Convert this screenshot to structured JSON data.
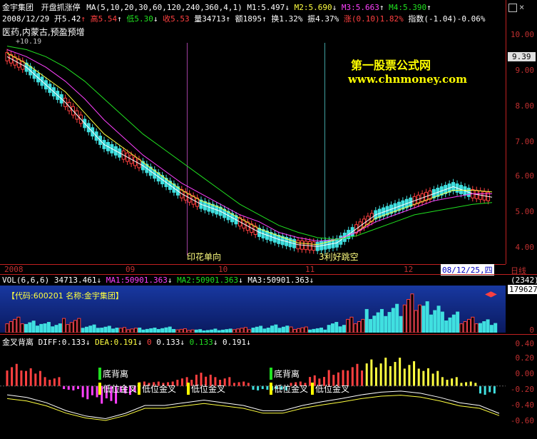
{
  "header": {
    "stock_name": "金宇集团",
    "indicator_name": "开盘抓涨停",
    "ma_params": "MA(5,10,20,30,60,120,240,360,4,1)",
    "m1": "M1:5.497",
    "m2": "M2:5.690",
    "m3": "M3:5.663",
    "m4": "M4:5.390",
    "date": "2008/12/29",
    "open": "开5.42",
    "high": "高5.54",
    "low": "低5.30",
    "close": "收5.53",
    "volume": "量34713",
    "amount": "额1895",
    "turnover": "换1.32%",
    "amplitude": "振4.37%",
    "change": "涨(0.10)1.82%",
    "index": "指数(-1.04)-0.06%",
    "concepts": "医药,内蒙古,预盈预增",
    "extra": "+10.19",
    "arrow_up": "↑",
    "arrow_down": "↓"
  },
  "watermark": {
    "line1": "第一股票公式网",
    "line2": "www.chnmoney.com"
  },
  "price_axis": {
    "labels": [
      "10.00",
      "9.39",
      "9.00",
      "8.00",
      "7.00",
      "6.00",
      "5.00",
      "4.00"
    ],
    "current": "9.39"
  },
  "annotations": {
    "stamp_duty": "印花单向",
    "good_news": "3利好跳空"
  },
  "time_axis": {
    "labels": [
      "2008",
      "09",
      "10",
      "11",
      "12"
    ],
    "cursor_date": "08/12/25,四",
    "period": "日线"
  },
  "vol_panel": {
    "title": "VOL(6,6,6)",
    "value": "34713.461",
    "ma1": "MA1:50901.363",
    "ma2": "MA2:50901.363",
    "ma3": "MA3:50901.363",
    "code_text": "【代码:600201 名称:金宇集团】",
    "axis_top": "(2342)",
    "axis_current": "179627",
    "axis_zero": "0"
  },
  "macd_panel": {
    "title": "金叉背离",
    "diff": "DIFF:0.133",
    "dea": "DEA:0.191",
    "v0": "0",
    "v1": "0.133",
    "v2": "0.133",
    "v3": "0.191",
    "labels_bottom_divergence": [
      "底背离",
      "底背离"
    ],
    "labels_golden_cross": [
      "低位金叉",
      "低位金叉",
      "低位金叉",
      "低位金叉",
      "低位金叉"
    ],
    "axis": [
      "0.40",
      "0.20",
      "0.00",
      "-0.20",
      "-0.40",
      "-0.60"
    ]
  },
  "chart_data": [
    {
      "type": "line",
      "title": "",
      "ylim": [
        3.8,
        10.3
      ],
      "series": [
        {
          "name": "M1",
          "values": [
            9.5,
            9.2,
            8.7,
            8.2,
            7.6,
            7.0,
            6.7,
            6.4,
            6.0,
            5.6,
            5.3,
            5.1,
            4.8,
            4.5,
            4.3,
            4.15,
            4.1,
            4.2,
            4.6,
            5.0,
            5.2,
            5.4,
            5.6,
            5.8,
            5.6,
            5.5
          ]
        },
        {
          "name": "M2",
          "values": [
            9.6,
            9.3,
            8.9,
            8.5,
            7.9,
            7.3,
            6.9,
            6.5,
            6.1,
            5.7,
            5.4,
            5.2,
            4.9,
            4.6,
            4.4,
            4.2,
            4.15,
            4.3,
            4.5,
            4.9,
            5.1,
            5.3,
            5.5,
            5.7,
            5.7,
            5.65
          ]
        },
        {
          "name": "M3",
          "values": [
            9.7,
            9.5,
            9.2,
            8.8,
            8.3,
            7.7,
            7.2,
            6.7,
            6.3,
            5.9,
            5.6,
            5.3,
            5.0,
            4.8,
            4.5,
            4.35,
            4.25,
            4.3,
            4.5,
            4.8,
            5.0,
            5.2,
            5.4,
            5.5,
            5.6,
            5.6
          ]
        },
        {
          "name": "M4",
          "values": [
            9.8,
            9.7,
            9.5,
            9.2,
            8.8,
            8.3,
            7.8,
            7.3,
            6.9,
            6.5,
            6.1,
            5.7,
            5.3,
            5.0,
            4.7,
            4.5,
            4.35,
            4.3,
            4.4,
            4.6,
            4.8,
            5.0,
            5.1,
            5.2,
            5.3,
            5.35
          ]
        }
      ]
    },
    {
      "type": "bar",
      "title": "",
      "ylim": [
        0,
        180000
      ],
      "values": [
        60000,
        45000,
        40000,
        55000,
        30000,
        25000,
        20000,
        18000,
        22000,
        15000,
        12000,
        14000,
        20000,
        25000,
        30000,
        22000,
        18000,
        40000,
        60000,
        90000,
        110000,
        150000,
        120000,
        80000,
        60000,
        50000
      ]
    },
    {
      "type": "bar",
      "title": "",
      "ylim": [
        -0.6,
        0.45
      ],
      "values": [
        0.25,
        0.2,
        0.1,
        -0.05,
        -0.15,
        -0.2,
        -0.1,
        0.05,
        0.05,
        0.1,
        0.15,
        0.1,
        0.05,
        -0.05,
        -0.05,
        0.05,
        0.12,
        0.18,
        0.25,
        0.3,
        0.32,
        0.28,
        0.2,
        0.1,
        0.05,
        -0.1
      ]
    }
  ]
}
